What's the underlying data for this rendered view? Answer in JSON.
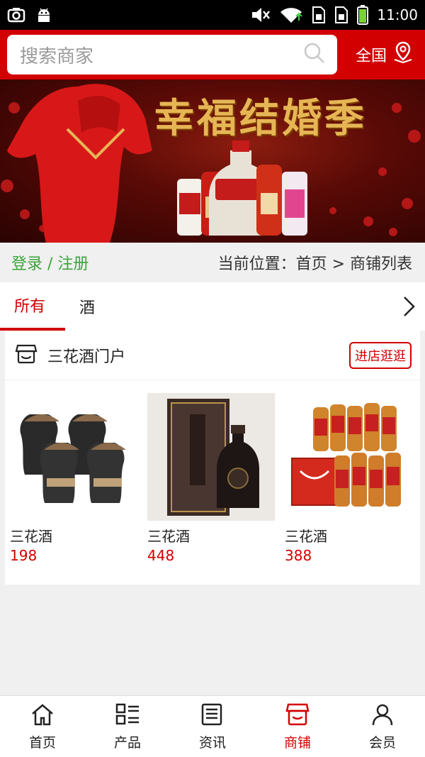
{
  "status_bar": {
    "left_icons": [
      "screenshot-icon",
      "android-icon"
    ],
    "right_icons": [
      "mute-icon",
      "wifi-icon",
      "sim-icon",
      "sim2-icon",
      "battery-icon"
    ],
    "time": "11:00"
  },
  "header": {
    "search_placeholder": "搜索商家",
    "region_label": "全国"
  },
  "banner": {
    "title": "幸福结婚季"
  },
  "location_bar": {
    "login": "登录 / 注册",
    "breadcrumb": "当前位置：首页 > 商铺列表"
  },
  "tabs": [
    {
      "label": "所有",
      "active": true
    },
    {
      "label": "酒",
      "active": false
    }
  ],
  "shop": {
    "name": "三花酒门户",
    "enter_button": "进店逛逛",
    "products": [
      {
        "name": "三花酒",
        "price": "198"
      },
      {
        "name": "三花酒",
        "price": "448"
      },
      {
        "name": "三花酒",
        "price": "388"
      }
    ]
  },
  "bottom_nav": [
    {
      "label": "首页",
      "icon": "home-icon"
    },
    {
      "label": "产品",
      "icon": "grid-list-icon"
    },
    {
      "label": "资讯",
      "icon": "news-icon"
    },
    {
      "label": "商铺",
      "icon": "shop-icon",
      "active": true
    },
    {
      "label": "会员",
      "icon": "user-icon"
    }
  ],
  "colors": {
    "brand": "#d20000",
    "login_green": "#3aa53a"
  }
}
